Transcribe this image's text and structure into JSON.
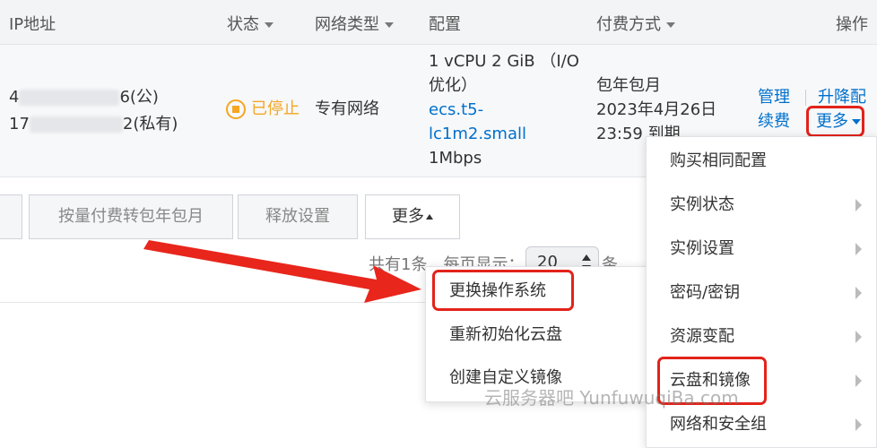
{
  "header": {
    "ip": "IP地址",
    "status": "状态",
    "network": "网络类型",
    "config": "配置",
    "billing": "付费方式",
    "actions": "操作"
  },
  "row": {
    "ip_public_prefix": "4",
    "ip_public_suffix": "6(公)",
    "ip_private_prefix": "17",
    "ip_private_suffix": "2(私有)",
    "status": "已停止",
    "network": "专有网络",
    "config_line1": "1 vCPU 2 GiB （I/O",
    "config_line2": "优化）",
    "config_link1": "ecs.t5-",
    "config_link2": "lc1m2.small",
    "config_line3": "1Mbps",
    "billing_line1": "包年包月",
    "billing_line2": "2023年4月26日",
    "billing_line3": "23:59 到期",
    "manage": "管理",
    "renew": "续费",
    "upgrade": "升降配",
    "more": "更多"
  },
  "buttons": {
    "convert": "按量付费转包年包月",
    "release": "释放设置",
    "more": "更多"
  },
  "pager": {
    "total": "共有1条，每页显示：",
    "page_size": "20",
    "unit": "条"
  },
  "submenu": {
    "items": [
      "更换操作系统",
      "重新初始化云盘",
      "创建自定义镜像"
    ]
  },
  "menu": {
    "items": [
      "购买相同配置",
      "实例状态",
      "实例设置",
      "密码/密钥",
      "资源变配",
      "云盘和镜像",
      "网络和安全组"
    ]
  },
  "watermark": "云服务器吧 YunfuwuqiBa.com",
  "colors": {
    "link": "#0070cc",
    "stopped": "#f5a623",
    "highlight": "#e2231a",
    "arrow": "#e8261c"
  }
}
